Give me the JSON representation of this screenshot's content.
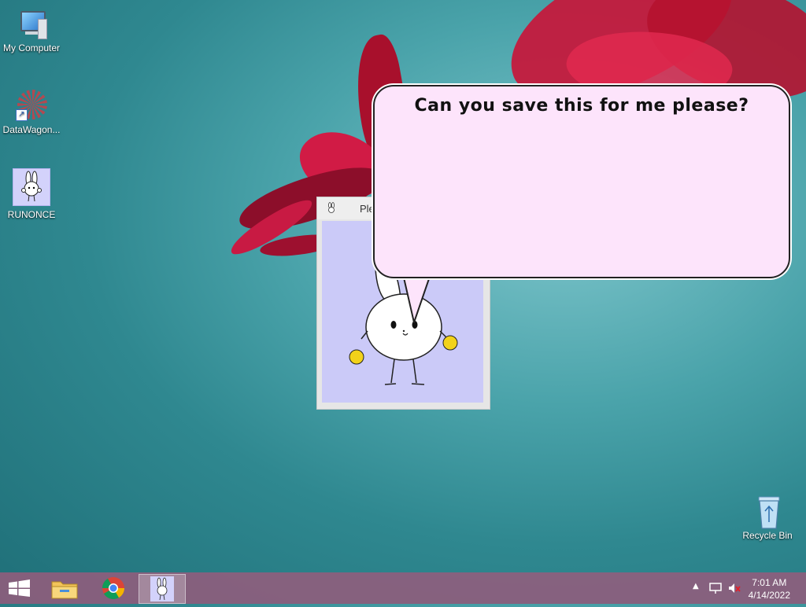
{
  "desktop": {
    "icons": [
      {
        "label": "My Computer",
        "icon": "computer-icon"
      },
      {
        "label": "DataWagon...",
        "icon": "datawagon-icon"
      },
      {
        "label": "RUNONCE",
        "icon": "bunny-icon"
      }
    ],
    "recycle_bin": {
      "label": "Recycle Bin",
      "icon": "recycle-bin-icon"
    }
  },
  "app_window": {
    "title": "Ple",
    "icon": "bunny-icon",
    "background_color": "#cbcaf8"
  },
  "speech_bubble": {
    "text": "Can you save this for me please?",
    "background_color": "#fde4fb"
  },
  "taskbar": {
    "buttons": [
      {
        "name": "start",
        "icon": "windows-logo-icon"
      },
      {
        "name": "file-explorer",
        "icon": "folder-icon"
      },
      {
        "name": "chrome",
        "icon": "chrome-icon"
      },
      {
        "name": "runonce",
        "icon": "bunny-icon",
        "active": true
      }
    ],
    "tray": {
      "icons": [
        "chevron-up-icon",
        "network-icon",
        "volume-muted-icon"
      ],
      "time": "7:01 AM",
      "date": "4/14/2022"
    },
    "color": "#965c7d"
  }
}
